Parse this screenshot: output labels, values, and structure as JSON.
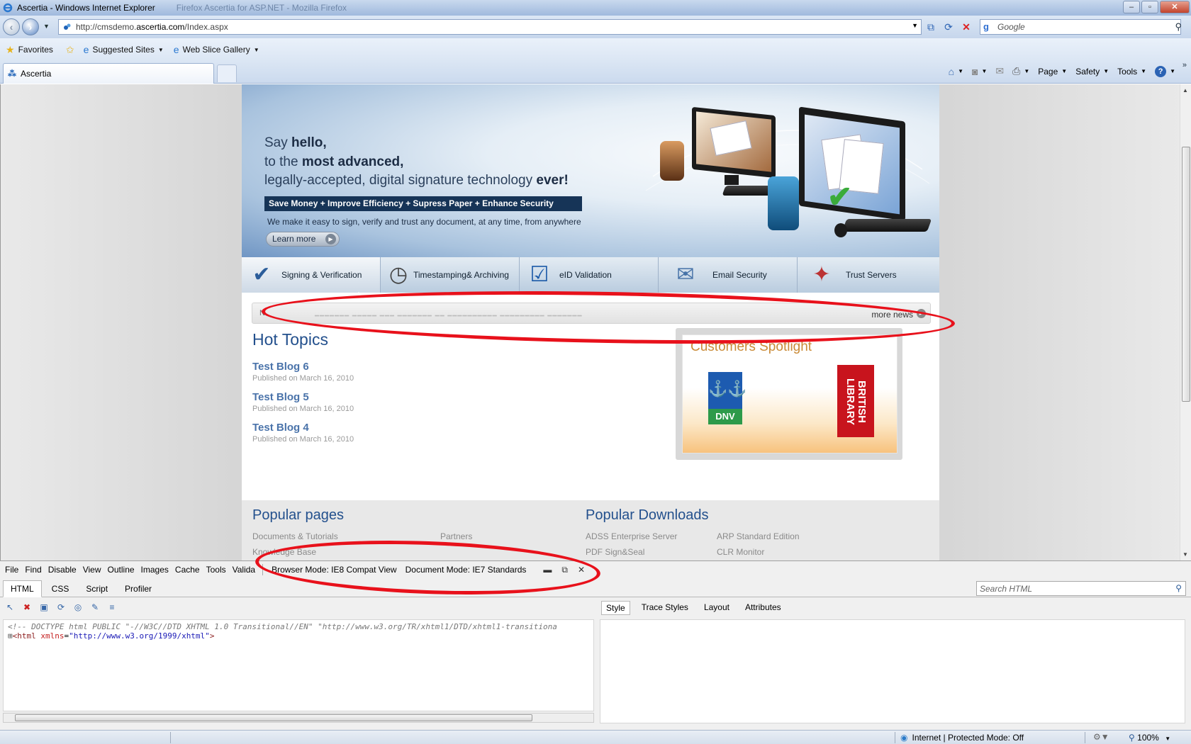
{
  "window": {
    "title": "Ascertia - Windows Internet Explorer",
    "ghost_title": "Firefox Ascertia for ASP.NET - Mozilla Firefox"
  },
  "address_bar": {
    "url_prefix": "http://cmsdemo.",
    "url_domain": "ascertia.com",
    "url_suffix": "/Index.aspx",
    "search_placeholder": "Google"
  },
  "favorites_bar": {
    "favorites_label": "Favorites",
    "items": [
      "Suggested Sites",
      "Web Slice Gallery"
    ]
  },
  "tabs": {
    "active_label": "Ascertia"
  },
  "command_bar": {
    "page": "Page",
    "safety": "Safety",
    "tools": "Tools"
  },
  "banner": {
    "line1_a": "Say ",
    "line1_b": "hello,",
    "line2_a": "to the ",
    "line2_b": "most advanced,",
    "line3_a": "legally-accepted, digital signature technology ",
    "line3_b": "ever!",
    "tagline": "Save Money  +  Improve Efficiency  +  Supress Paper  +  Enhance Security",
    "subline": "We make it easy to sign, verify and trust any document, at any time, from anywhere",
    "learn_more": "Learn more"
  },
  "product_tabs": [
    {
      "label": "Signing & Verification",
      "icon": "check-document-icon"
    },
    {
      "label": "Timestamping& Archiving",
      "icon": "clock-icon"
    },
    {
      "label": "eID Validation",
      "icon": "person-check-icon"
    },
    {
      "label": "Email Security",
      "icon": "envelope-pen-icon"
    },
    {
      "label": "Trust Servers",
      "icon": "server-star-icon"
    }
  ],
  "news": {
    "label": "N",
    "more": "more news"
  },
  "hot_topics": {
    "title": "Hot Topics",
    "posts": [
      {
        "title": "Test Blog 6",
        "date": "Published on March 16, 2010"
      },
      {
        "title": "Test Blog 5",
        "date": "Published on March 16, 2010"
      },
      {
        "title": "Test Blog 4",
        "date": "Published on March 16, 2010"
      }
    ]
  },
  "spotlight": {
    "title": "Customers Spotlight",
    "logo1": "DNV",
    "logo2": "BRITISH LIBRARY"
  },
  "popular_pages": {
    "title": "Popular pages",
    "links": [
      "Documents & Tutorials",
      "Partners",
      "Knowledge Base"
    ]
  },
  "popular_downloads": {
    "title": "Popular Downloads",
    "links": [
      "ADSS Enterprise Server",
      "ARP Standard Edition",
      "PDF Sign&Seal",
      "CLR Monitor"
    ]
  },
  "devtools": {
    "menu": [
      "File",
      "Find",
      "Disable",
      "View",
      "Outline",
      "Images",
      "Cache",
      "Tools",
      "Valida"
    ],
    "browser_mode": "Browser Mode:  IE8 Compat View",
    "document_mode": "Document Mode:  IE7 Standards",
    "tabs": [
      "HTML",
      "CSS",
      "Script",
      "Profiler"
    ],
    "search_placeholder": "Search HTML",
    "right_tabs": [
      "Style",
      "Trace Styles",
      "Layout",
      "Attributes"
    ],
    "code_line1": "<!-- DOCTYPE html PUBLIC \"-//W3C//DTD XHTML 1.0 Transitional//EN\" \"http://www.w3.org/TR/xhtml1/DTD/xhtml1-transitiona",
    "code_line2_tag": "<html ",
    "code_line2_attr": "xmlns",
    "code_line2_val": "\"http://www.w3.org/1999/xhtml\"",
    "code_line2_end": ">"
  },
  "status_bar": {
    "zone": "Internet | Protected Mode: Off",
    "zoom": "100%"
  },
  "colors": {
    "annotation": "#e8111b",
    "link": "#4a73aa",
    "heading": "#23508d"
  }
}
